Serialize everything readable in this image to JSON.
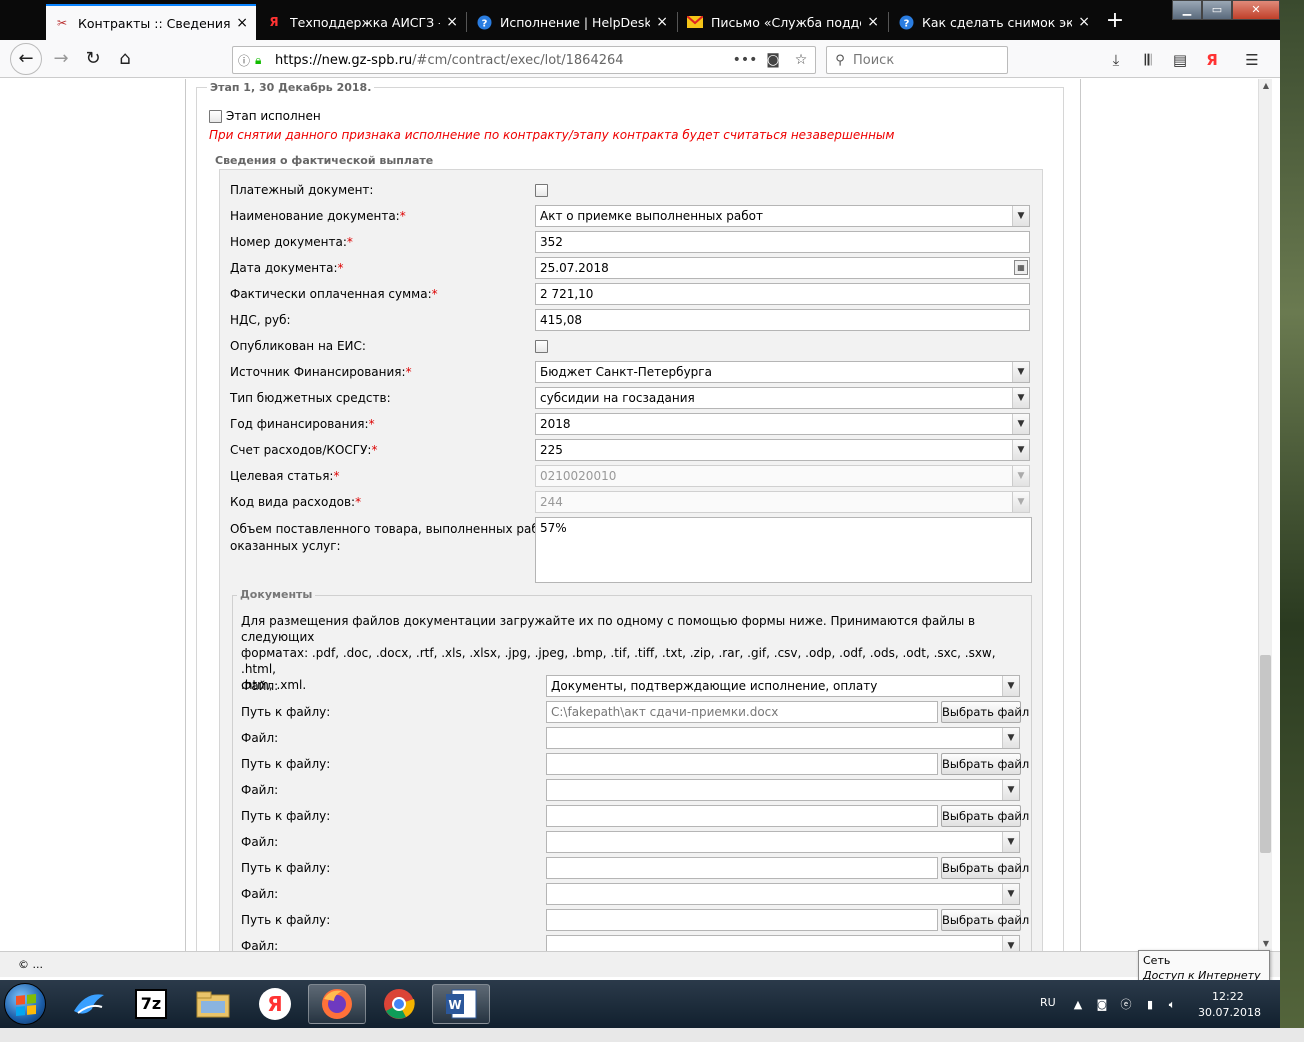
{
  "browser": {
    "tabs": [
      {
        "title": "Контракты :: Сведения об и",
        "active": true
      },
      {
        "title": "Техподдержка АИСГЗ — Ян",
        "active": false
      },
      {
        "title": "Исполнение | HelpDesk - с",
        "active": false
      },
      {
        "title": "Письмо «Служба поддерж",
        "active": false
      },
      {
        "title": "Как сделать снимок экрана",
        "active": false
      }
    ],
    "url_host": "https://new.gz-spb.ru",
    "url_rest": "/#cm/contract/exec/lot/1864264",
    "search_placeholder": "Поиск",
    "tab_close": "×",
    "new_tab": "+"
  },
  "stage": {
    "legend": "Этап 1, 30 Декабрь 2018.",
    "completed_label": "Этап исполнен",
    "warning": "При снятии данного признака исполнение по контракту/этапу контракта будет считаться незавершенным"
  },
  "payment": {
    "legend": "Сведения о фактической выплате",
    "fields": {
      "payment_doc": {
        "label": "Платежный документ:"
      },
      "doc_name": {
        "label": "Наименование документа:",
        "value": "Акт о приемке выполненных работ"
      },
      "doc_number": {
        "label": "Номер документа:",
        "value": "352"
      },
      "doc_date": {
        "label": "Дата документа:",
        "value": "25.07.2018"
      },
      "paid_sum": {
        "label": "Фактически оплаченная сумма:",
        "value": "2 721,10"
      },
      "vat": {
        "label": "НДС, руб:",
        "value": "415,08"
      },
      "published": {
        "label": "Опубликован на ЕИС:"
      },
      "funding_source": {
        "label": "Источник Финансирования:",
        "value": "Бюджет Санкт-Петербурга"
      },
      "budget_type": {
        "label": "Тип бюджетных средств:",
        "value": "субсидии на госзадания"
      },
      "funding_year": {
        "label": "Год финансирования:",
        "value": "2018"
      },
      "expense_account": {
        "label": "Счет расходов/КОСГУ:",
        "value": "225"
      },
      "target_item": {
        "label": "Целевая статья:",
        "value": "0210020010"
      },
      "expense_code": {
        "label": "Код вида расходов:",
        "value": "244"
      },
      "volume_line1": "Объем поставленного товара, выполненных работ,",
      "volume_line2": "оказанных услуг:",
      "volume_value": "57%"
    },
    "required_mark": "*"
  },
  "documents": {
    "legend": "Документы",
    "desc_line1": "Для размещения файлов документации загружайте их по одному с помощью формы ниже. Принимаются файлы в следующих",
    "desc_line2": "форматах: .pdf, .doc, .docx, .rtf, .xls, .xlsx, .jpg, .jpeg, .bmp, .tif, .tiff, .txt, .zip, .rar, .gif, .csv, .odp, .odf, .ods, .odt, .sxc, .sxw, .html,",
    "desc_line3": ".htm, .xml.",
    "file_label": "Файл:",
    "path_label": "Путь к файлу:",
    "choose_button": "Выбрать файл",
    "rows": [
      {
        "file_value": "Документы, подтверждающие исполнение, оплату",
        "path_value": "C:\\fakepath\\акт сдачи-приемки.docx"
      },
      {
        "file_value": "",
        "path_value": ""
      },
      {
        "file_value": "",
        "path_value": ""
      },
      {
        "file_value": "",
        "path_value": ""
      },
      {
        "file_value": "",
        "path_value": ""
      }
    ]
  },
  "status": {
    "text": "© ...",
    "tooltip_title": "Сеть",
    "tooltip_body": "Доступ к Интернету"
  },
  "taskbar": {
    "lang": "RU",
    "time": "12:22",
    "date": "30.07.2018",
    "app_7zip": "7z"
  }
}
